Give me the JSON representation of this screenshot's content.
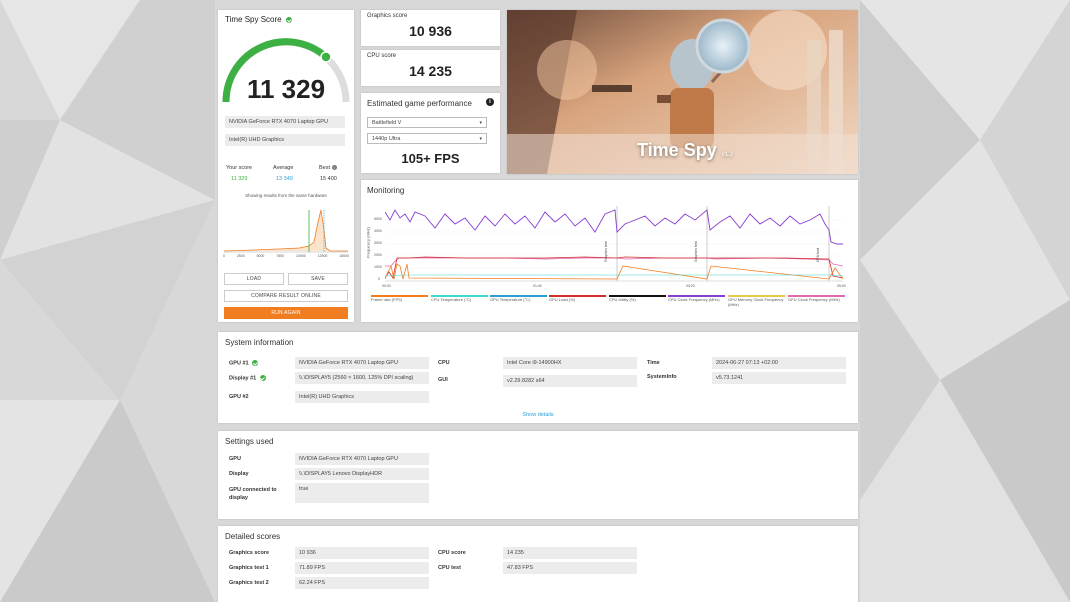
{
  "colors": {
    "accent": "#f07d20",
    "green": "#3cb043",
    "blue": "#2a9fd6",
    "purple": "#7b2fbe"
  },
  "score_panel": {
    "title": "Time Spy Score",
    "score": "11 329",
    "gpu": "NVIDIA GeForce RTX 4070 Laptop GPU",
    "igpu": "Intel(R) UHD Graphics",
    "your_score_label": "Your score",
    "your_score": "11 329",
    "average_label": "Average",
    "average": "13 349",
    "best_label": "Best",
    "best": "15 400",
    "hardware_note": "Showing results from the same hardware",
    "axis_ticks": [
      "0",
      "2500",
      "5000",
      "7500",
      "10000",
      "12500",
      "15000"
    ],
    "load": "LOAD",
    "save": "SAVE",
    "compare": "COMPARE RESULT ONLINE",
    "run_again": "RUN AGAIN"
  },
  "graphics_score": {
    "label": "Graphics score",
    "value": "10 936"
  },
  "cpu_score": {
    "label": "CPU score",
    "value": "14 235"
  },
  "game_perf": {
    "title": "Estimated game performance",
    "game": "Battlefield V",
    "resolution": "1440p Ultra",
    "fps": "105+ FPS"
  },
  "hero": {
    "title": "Time Spy",
    "version": "v1.2"
  },
  "monitoring": {
    "title": "Monitoring",
    "y_axis_label": "Frequency (MHz)",
    "y_ticks": [
      "5000",
      "4000",
      "3000",
      "2000",
      "1000",
      "0"
    ],
    "x_ticks": [
      "00:00",
      "01:40",
      "03:20",
      "05:00"
    ],
    "markers": [
      "Graphics test",
      "Graphics test",
      "CPU test"
    ],
    "legend": [
      {
        "label": "Frame rate (FPS)",
        "color": "#f07d20"
      },
      {
        "label": "CPU Temperature (°C)",
        "color": "#3fd6d6"
      },
      {
        "label": "GPU Temperature (°C)",
        "color": "#2a9fd6"
      },
      {
        "label": "GPU Load (%)",
        "color": "#d42b2b"
      },
      {
        "label": "CPU Utility (%)",
        "color": "#111111"
      },
      {
        "label": "CPU Clock Frequency (MHz)",
        "color": "#8a3fd0"
      },
      {
        "label": "GPU Memory Clock Frequency (MHz)",
        "color": "#e8c84a"
      },
      {
        "label": "GPU Clock Frequency (MHz)",
        "color": "#e06ab0"
      }
    ]
  },
  "system_info": {
    "title": "System information",
    "gpu1_label": "GPU #1",
    "gpu1": "NVIDIA GeForce RTX 4070 Laptop GPU",
    "display1_label": "Display #1",
    "display1": "\\\\.\\DISPLAY5 (2560 × 1600, 125% DPI scaling)",
    "gpu2_label": "GPU #2",
    "gpu2": "Intel(R) UHD Graphics",
    "cpu_label": "CPU",
    "cpu": "Intel Core i9-14900HX",
    "gui_label": "GUI",
    "gui": "v2.29.8282 s64",
    "time_label": "Time",
    "time": "2024-06-27 07:13 +02:00",
    "sysinfo_label": "SystemInfo",
    "sysinfo": "v5.73.1241",
    "show_details": "Show details"
  },
  "settings": {
    "title": "Settings used",
    "gpu_label": "GPU",
    "gpu": "NVIDIA GeForce RTX 4070 Laptop GPU",
    "display_label": "Display",
    "display": "\\\\.\\DISPLAY5 Lenovo DisplayHDR",
    "connected_label": "GPU connected to display",
    "connected": "true"
  },
  "detailed": {
    "title": "Detailed scores",
    "gs_label": "Graphics score",
    "gs": "10 936",
    "gt1_label": "Graphics test 1",
    "gt1": "71.89 FPS",
    "gt2_label": "Graphics test 2",
    "gt2": "62.24 FPS",
    "cpu_label": "CPU score",
    "cpu": "14 235",
    "cput_label": "CPU test",
    "cput": "47.83 FPS"
  }
}
